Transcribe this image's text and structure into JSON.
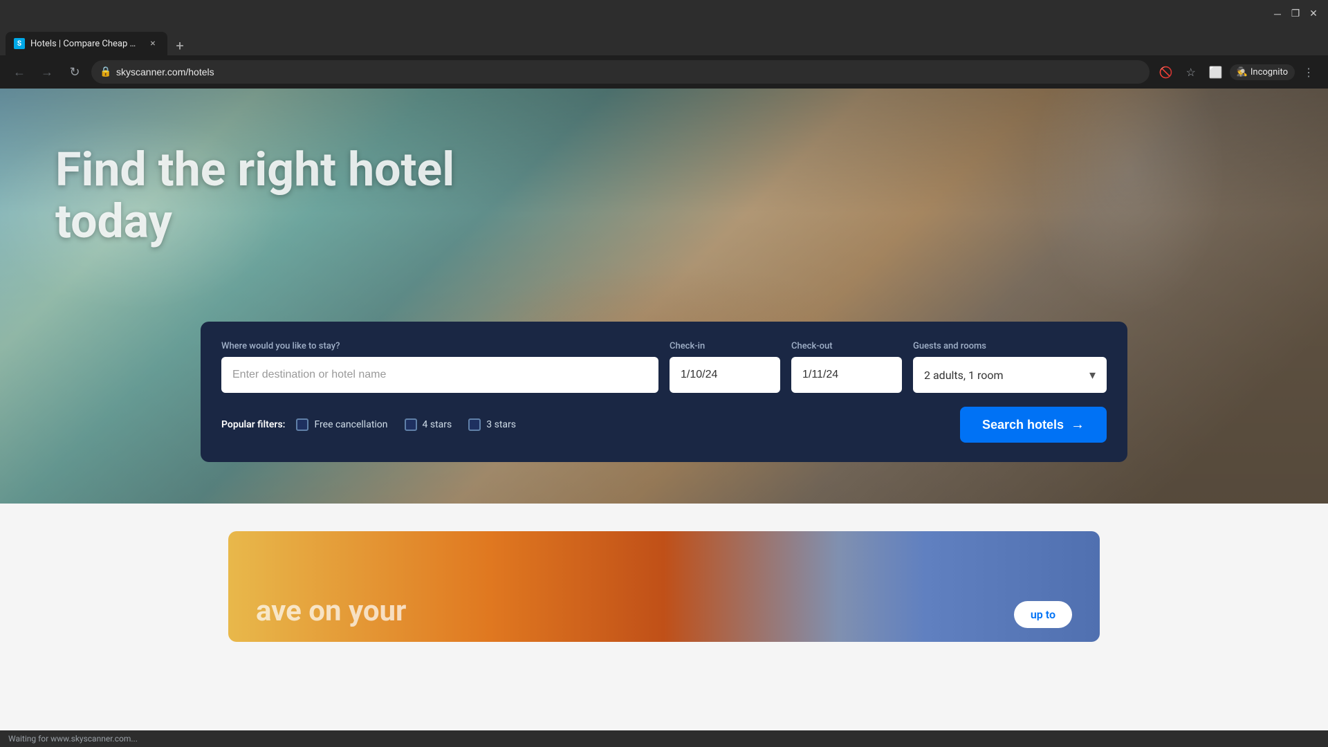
{
  "browser": {
    "tab_title": "Hotels | Compare Cheap Hotel",
    "favicon_letter": "S",
    "url": "skyscanner.com/hotels",
    "close_label": "×",
    "new_tab_label": "+",
    "incognito_label": "Incognito"
  },
  "hero": {
    "title": "Find the right hotel today"
  },
  "search": {
    "destination_label": "Where would you like to stay?",
    "destination_placeholder": "Enter destination or hotel name",
    "checkin_label": "Check-in",
    "checkin_value": "1/10/24",
    "checkout_label": "Check-out",
    "checkout_value": "1/11/24",
    "guests_label": "Guests and rooms",
    "guests_value": "2 adults, 1 room",
    "popular_filters_label": "Popular filters:",
    "filter1_label": "Free cancellation",
    "filter2_label": "4 stars",
    "filter3_label": "3 stars",
    "search_button_label": "Search hotels"
  },
  "bottom": {
    "card_text": "ave on your",
    "cta_label": "up to"
  },
  "status": {
    "waiting_text": "Waiting for www.skyscanner.com..."
  }
}
